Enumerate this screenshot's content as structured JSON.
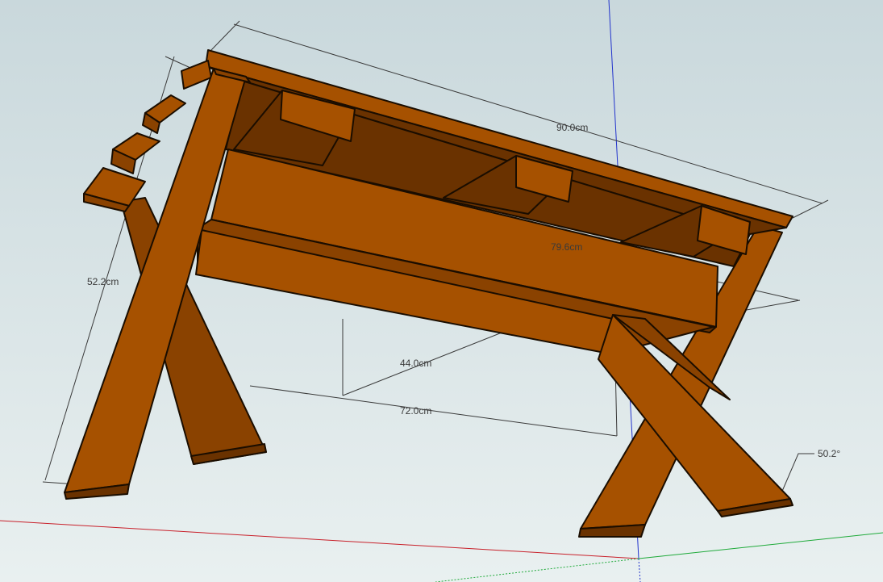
{
  "dimensions": {
    "top_length": "90.0cm",
    "inner_length": "79.6cm",
    "height": "52.2cm",
    "depth": "44.0cm",
    "leg_span": "72.0cm",
    "leg_angle": "50.2°"
  },
  "colors": {
    "background_top": "#c9d8dc",
    "background_bottom": "#e9f0f0",
    "wood_light": "#a65100",
    "wood_mid": "#8a4200",
    "wood_dark": "#6a3200",
    "outline": "#1a0d00",
    "axis_red": "#c8202a",
    "axis_green": "#1faa3a",
    "axis_blue": "#2233cc",
    "dimension_line": "#3a3a3a"
  }
}
